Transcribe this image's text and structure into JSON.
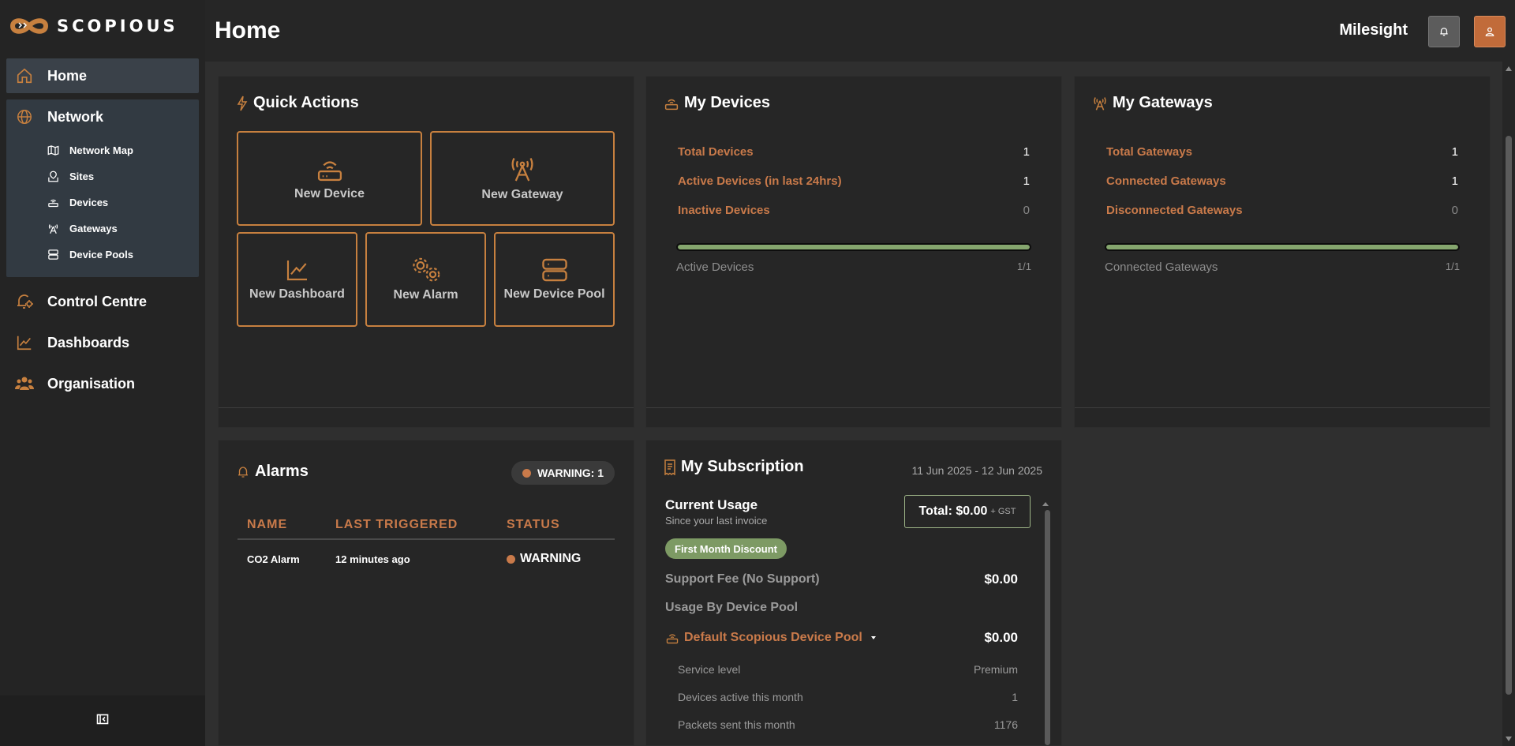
{
  "brand": {
    "name": "SCOPIOUS",
    "accent": "#c7803f"
  },
  "header": {
    "title": "Home",
    "org": "Milesight"
  },
  "sidebar": {
    "home": "Home",
    "network": "Network",
    "network_items": [
      "Network Map",
      "Sites",
      "Devices",
      "Gateways",
      "Device Pools"
    ],
    "control_centre": "Control Centre",
    "dashboards": "Dashboards",
    "organisation": "Organisation"
  },
  "quick_actions": {
    "title": "Quick Actions",
    "items": [
      "New Device",
      "New Gateway",
      "New Dashboard",
      "New Alarm",
      "New Device Pool"
    ]
  },
  "devices": {
    "title": "My Devices",
    "total_label": "Total Devices",
    "total": "1",
    "active_label": "Active Devices (in last 24hrs)",
    "active": "1",
    "inactive_label": "Inactive Devices",
    "inactive": "0",
    "progress_label": "Active Devices",
    "progress_ratio": "1/1",
    "progress_fraction": 1.0
  },
  "gateways": {
    "title": "My Gateways",
    "total_label": "Total Gateways",
    "total": "1",
    "connected_label": "Connected Gateways",
    "connected": "1",
    "disconnected_label": "Disconnected Gateways",
    "disconnected": "0",
    "progress_label": "Connected Gateways",
    "progress_ratio": "1/1",
    "progress_fraction": 1.0
  },
  "alarms": {
    "title": "Alarms",
    "badge": "WARNING: 1",
    "columns": [
      "NAME",
      "LAST TRIGGERED",
      "STATUS"
    ],
    "rows": [
      {
        "name": "CO2 Alarm",
        "last_triggered": "12 minutes ago",
        "status": "WARNING"
      }
    ]
  },
  "subscription": {
    "title": "My Subscription",
    "dates": "11 Jun 2025  -  12 Jun 2025",
    "usage_title": "Current Usage",
    "usage_sub": "Since your last invoice",
    "total": "Total: $0.00",
    "total_suffix": "+ GST",
    "discount": "First Month Discount",
    "support_label": "Support Fee (No Support)",
    "support_value": "$0.00",
    "by_pool_label": "Usage By Device Pool",
    "pool_name": "Default Scopious Device Pool",
    "pool_value": "$0.00",
    "details": [
      {
        "label": "Service level",
        "value": "Premium"
      },
      {
        "label": "Devices active this month",
        "value": "1"
      },
      {
        "label": "Packets sent this month",
        "value": "1176"
      }
    ]
  }
}
